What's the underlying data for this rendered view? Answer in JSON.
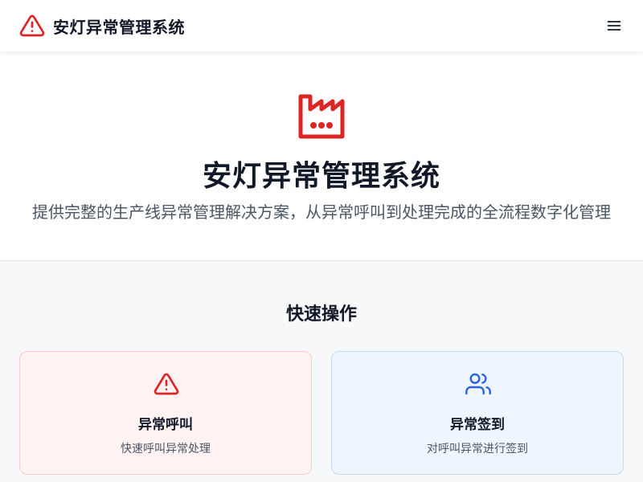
{
  "header": {
    "title": "安灯异常管理系统",
    "logo_icon": "warning-triangle-icon",
    "menu_icon": "hamburger-menu-icon"
  },
  "hero": {
    "icon": "factory-icon",
    "title": "安灯异常管理系统",
    "subtitle": "提供完整的生产线异常管理解决方案，从异常呼叫到处理完成的全流程数字化管理"
  },
  "quick_actions": {
    "title": "快速操作",
    "items": [
      {
        "icon": "warning-triangle-icon",
        "title": "异常呼叫",
        "description": "快速呼叫异常处理",
        "accent": "#dc2626"
      },
      {
        "icon": "users-icon",
        "title": "异常签到",
        "description": "对呼叫异常进行签到",
        "accent": "#2563eb"
      }
    ]
  },
  "colors": {
    "brand_red": "#dc2626",
    "brand_blue": "#2563eb",
    "card_red_bg": "#fef2f2",
    "card_blue_bg": "#eff6ff"
  }
}
